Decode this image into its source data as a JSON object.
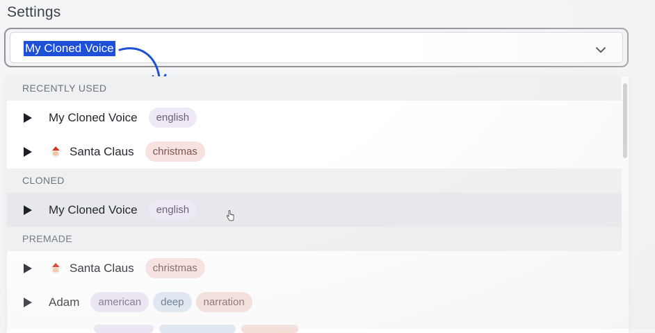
{
  "settings_title": "Settings",
  "select": {
    "selected_value": "My Cloned Voice"
  },
  "sections": {
    "recently_used": {
      "header": "RECENTLY USED",
      "items": [
        {
          "name": "My Cloned Voice",
          "tags": [
            "english"
          ]
        },
        {
          "name": "Santa Claus",
          "emoji": "santa-icon",
          "tags": [
            "christmas"
          ]
        }
      ]
    },
    "cloned": {
      "header": "CLONED",
      "items": [
        {
          "name": "My Cloned Voice",
          "tags": [
            "english"
          ]
        }
      ]
    },
    "premade": {
      "header": "PREMADE",
      "items": [
        {
          "name": "Santa Claus",
          "emoji": "santa-icon",
          "tags": [
            "christmas"
          ]
        },
        {
          "name": "Adam",
          "tags": [
            "american",
            "deep",
            "narration"
          ]
        }
      ]
    }
  },
  "colors": {
    "selection_highlight": "#1d4fd7",
    "annotation_arrow": "#1d4fd7"
  }
}
